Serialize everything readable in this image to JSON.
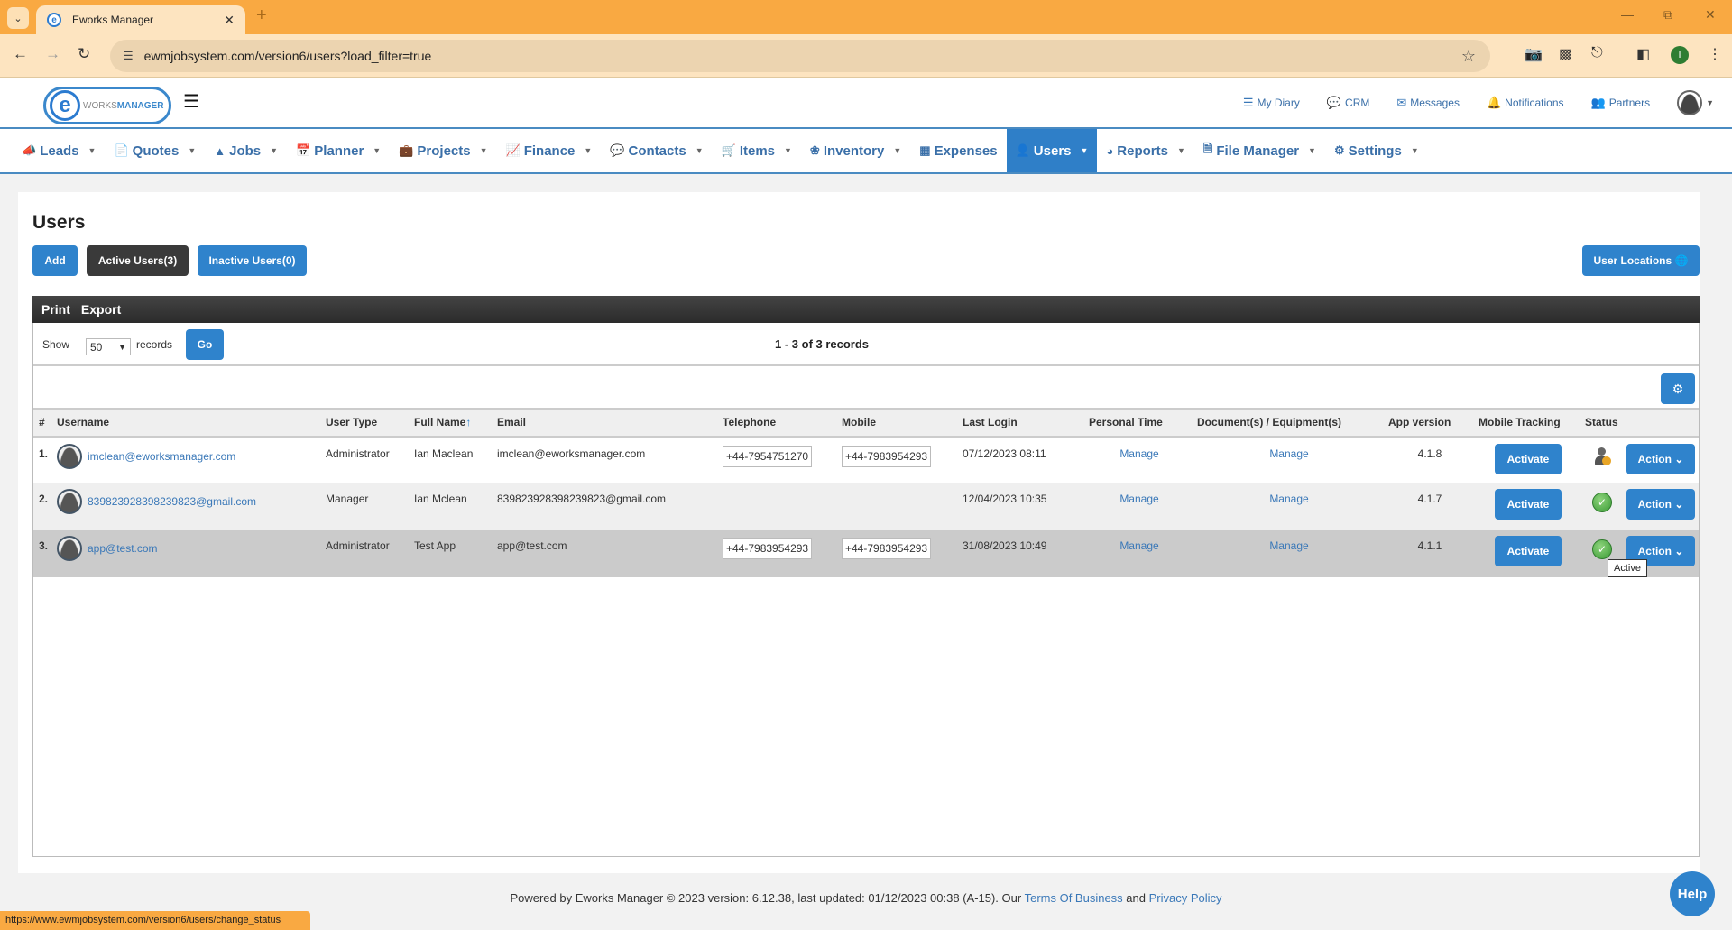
{
  "browser": {
    "tab_title": "Eworks Manager",
    "url": "ewmjobsystem.com/version6/users?load_filter=true",
    "profile_initial": "I",
    "status_url": "https://www.ewmjobsystem.com/version6/users/change_status"
  },
  "header": {
    "logo_prefix": "WORKS",
    "logo_suffix": "MANAGER",
    "links": [
      {
        "label": "My Diary",
        "icon": "list-icon"
      },
      {
        "label": "CRM",
        "icon": "comments-icon"
      },
      {
        "label": "Messages",
        "icon": "envelope-icon"
      },
      {
        "label": "Notifications",
        "icon": "bell-icon"
      },
      {
        "label": "Partners",
        "icon": "users-icon"
      }
    ]
  },
  "nav": {
    "items": [
      {
        "label": "Leads",
        "icon": "bullhorn-icon",
        "dropdown": true
      },
      {
        "label": "Quotes",
        "icon": "file-icon",
        "dropdown": true
      },
      {
        "label": "Jobs",
        "icon": "road-icon",
        "dropdown": true
      },
      {
        "label": "Planner",
        "icon": "calendar-icon",
        "dropdown": true
      },
      {
        "label": "Projects",
        "icon": "briefcase-icon",
        "dropdown": true
      },
      {
        "label": "Finance",
        "icon": "chart-icon",
        "dropdown": true
      },
      {
        "label": "Contacts",
        "icon": "comments-icon",
        "dropdown": true
      },
      {
        "label": "Items",
        "icon": "cart-icon",
        "dropdown": true
      },
      {
        "label": "Inventory",
        "icon": "cubes-icon",
        "dropdown": true
      },
      {
        "label": "Expenses",
        "icon": "calculator-icon",
        "dropdown": false
      },
      {
        "label": "Users",
        "icon": "user-icon",
        "dropdown": true,
        "active": true
      },
      {
        "label": "Reports",
        "icon": "pie-chart-icon",
        "dropdown": true
      },
      {
        "label": "File Manager",
        "icon": "pdf-file-icon",
        "dropdown": true
      },
      {
        "label": "Settings",
        "icon": "cogs-icon",
        "dropdown": true
      }
    ]
  },
  "page": {
    "title": "Users",
    "add_label": "Add",
    "active_users_label": "Active Users(3)",
    "inactive_users_label": "Inactive Users(0)",
    "user_locations_label": "User Locations",
    "print_label": "Print",
    "export_label": "Export",
    "show_label": "Show",
    "records_label": "records",
    "page_size": "50",
    "go_label": "Go",
    "records_count": "1 - 3 of 3 records",
    "tooltip": "Active"
  },
  "table": {
    "headers": [
      "#",
      "Username",
      "User Type",
      "Full Name",
      "Email",
      "Telephone",
      "Mobile",
      "Last Login",
      "Personal Time",
      "Document(s) / Equipment(s)",
      "App version",
      "Mobile Tracking",
      "Status",
      ""
    ],
    "sorted_column": "Full Name",
    "rows": [
      {
        "num": "1.",
        "username": "imclean@eworksmanager.com",
        "user_type": "Administrator",
        "full_name": "Ian Maclean",
        "email": "imclean@eworksmanager.com",
        "telephone": "+44-7954751270",
        "mobile": "+44-7983954293",
        "last_login": "07/12/2023 08:11",
        "personal_time": "Manage",
        "documents": "Manage",
        "app_version": "4.1.8",
        "tracking": "Activate",
        "status": "logged-in-user",
        "action": "Action"
      },
      {
        "num": "2.",
        "username": "839823928398239823@gmail.com",
        "user_type": "Manager",
        "full_name": "Ian Mclean",
        "email": "839823928398239823@gmail.com",
        "telephone": "",
        "mobile": "",
        "last_login": "12/04/2023 10:35",
        "personal_time": "Manage",
        "documents": "Manage",
        "app_version": "4.1.7",
        "tracking": "Activate",
        "status": "active",
        "action": "Action"
      },
      {
        "num": "3.",
        "username": "app@test.com",
        "user_type": "Administrator",
        "full_name": "Test App",
        "email": "app@test.com",
        "telephone": "+44-7983954293",
        "mobile": "+44-7983954293",
        "last_login": "31/08/2023 10:49",
        "personal_time": "Manage",
        "documents": "Manage",
        "app_version": "4.1.1",
        "tracking": "Activate",
        "status": "active",
        "action": "Action"
      }
    ]
  },
  "footer": {
    "text": "Powered by Eworks Manager © 2023 version: 6.12.38, last updated: 01/12/2023 00:38 (A-15). Our ",
    "terms": "Terms Of Business",
    "and": " and ",
    "privacy": "Privacy Policy",
    "help": "Help"
  }
}
